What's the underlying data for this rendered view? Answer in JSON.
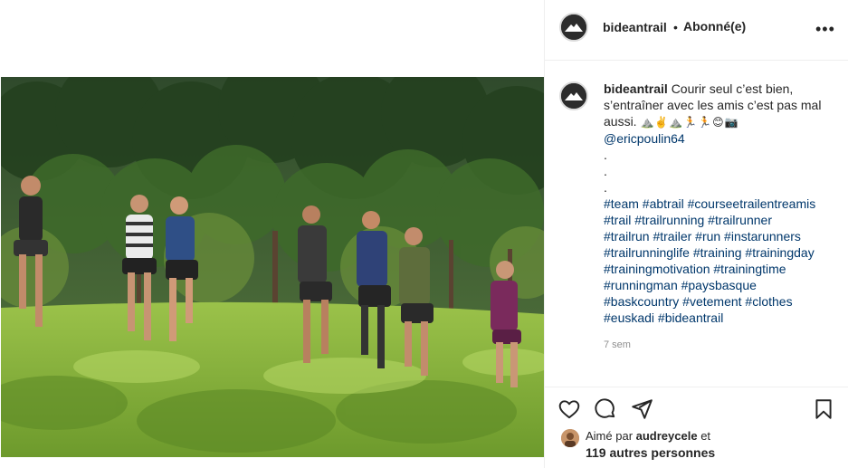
{
  "post": {
    "username": "bideantrail",
    "separator": "•",
    "follow_status": "Abonné(e)",
    "more_label": "•••",
    "caption": {
      "line1": "Courir seul c’est bien,",
      "line2": "s’entraîner avec les amis c’est pas mal",
      "line3": "aussi.",
      "emojis": "⛰️✌️⛰️🏃🏃😊📷",
      "mention": "@ericpoulin64",
      "dots": [
        ".",
        ".",
        "."
      ],
      "hashtag_lines": [
        "#team #abtrail #courseetrailentreamis",
        "#trail #trailrunning #trailrunner",
        "#trailrun #trailer #run #instarunners",
        "#trailrunninglife #training #trainingday",
        "#trainingmotivation #trainingtime",
        "#runningman #paysbasque",
        "#baskcountry #vetement #clothes",
        "#euskadi #bideantrail"
      ]
    },
    "timestamp": "7 sem",
    "likes": {
      "prefix": "Aimé par ",
      "first_liker": "audreycele",
      "suffix": " et",
      "others": "119 autres personnes"
    }
  },
  "icons": {
    "more": "more-options-icon",
    "like": "heart-icon",
    "comment": "comment-bubble-icon",
    "share": "paper-plane-icon",
    "save": "bookmark-icon"
  },
  "colors": {
    "link": "#00376b",
    "text": "#262626",
    "muted": "#8e8e8e",
    "border": "#efefef"
  }
}
